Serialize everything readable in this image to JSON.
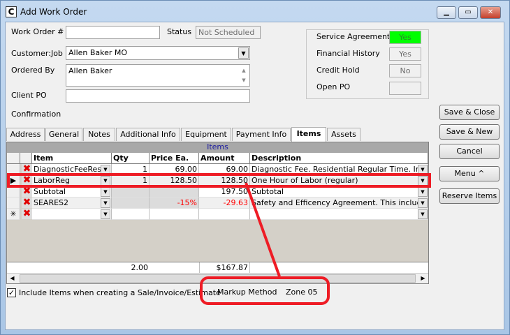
{
  "window": {
    "title": "Add Work Order",
    "icon": "app-icon",
    "minimize": "minimize-icon",
    "maximize": "maximize-icon",
    "close": "close-icon"
  },
  "form": {
    "work_order_label": "Work Order #",
    "work_order_value": "",
    "status_label": "Status",
    "status_value": "Not Scheduled",
    "customer_label": "Customer:Job",
    "customer_value": "Allen Baker MO",
    "ordered_by_label": "Ordered By",
    "ordered_by_value": "Allen Baker",
    "client_po_label": "Client PO",
    "client_po_value": "",
    "confirmation_label": "Confirmation"
  },
  "flags": [
    {
      "label": "Service Agreement",
      "value": "Yes",
      "color": "#00ff00"
    },
    {
      "label": "Financial History",
      "value": "Yes"
    },
    {
      "label": "Credit Hold",
      "value": "No"
    },
    {
      "label": "Open PO",
      "value": ""
    }
  ],
  "buttons": {
    "save_close": "Save & Close",
    "save_new": "Save & New",
    "cancel": "Cancel",
    "menu": "Menu ^",
    "reserve": "Reserve Items"
  },
  "tabs": [
    "Address",
    "General",
    "Notes",
    "Additional Info",
    "Equipment",
    "Payment Info",
    "Items",
    "Assets"
  ],
  "selected_tab": "Items",
  "grid": {
    "title": "Items",
    "columns": [
      "Item",
      "Qty",
      "Price Ea.",
      "Amount",
      "Description"
    ],
    "rows": [
      {
        "item": "DiagnosticFeeResR",
        "qty": "1",
        "price": "69.00",
        "amount": "69.00",
        "desc": "Diagnostic Fee. Residential Regular Time. Include"
      },
      {
        "item": "LaborReg",
        "qty": "1",
        "price": "128.50",
        "amount": "128.50",
        "desc": "One Hour of Labor (regular)",
        "current": true
      },
      {
        "item": "Subtotal",
        "qty": "",
        "price": "",
        "amount": "197.50",
        "desc": "Subtotal"
      },
      {
        "item": "SEARES2",
        "qty": "",
        "price": "-15%",
        "amount": "-29.63",
        "desc": "Safety and Efficency Agreement. This include our"
      },
      {
        "item": "",
        "qty": "",
        "price": "",
        "amount": "",
        "desc": "",
        "new": true
      }
    ],
    "totals": {
      "qty": "2.00",
      "amount": "$167.87"
    }
  },
  "footer": {
    "include_label": "Include Items when creating a Sale/Invoice/Estimate",
    "include_checked": true,
    "markup_label": "Markup Method",
    "markup_value": "Zone 05"
  },
  "annotation_color": "#ee1c25"
}
